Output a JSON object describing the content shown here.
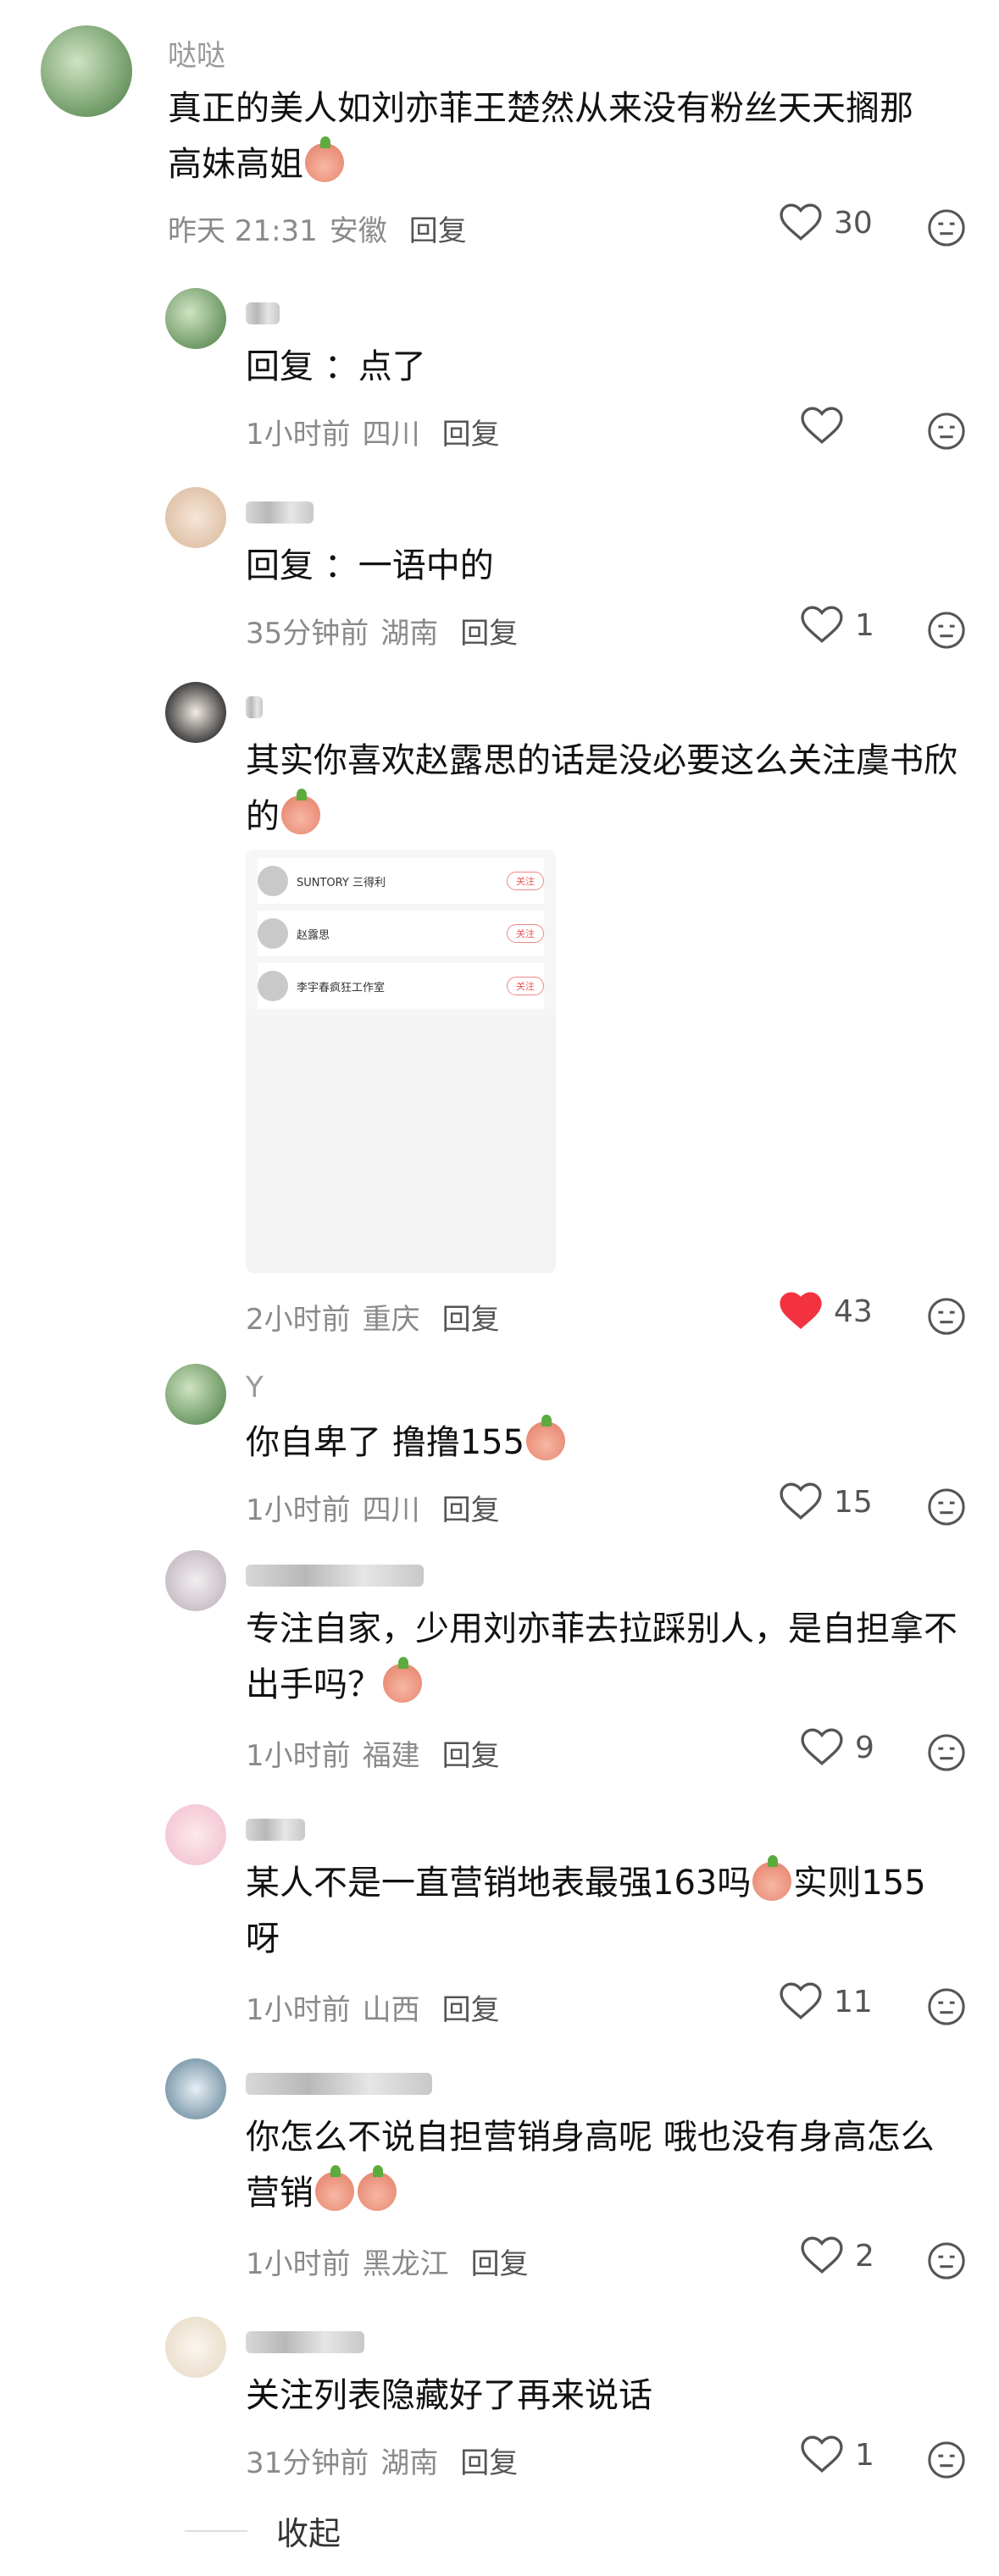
{
  "comments": [
    {
      "nickname": "哒哒",
      "text": "真正的美人如刘亦菲王楚然从来没有粉丝天天搁那高妹高姐",
      "time": "昨天 21:31",
      "location": "安徽",
      "reply": "回复",
      "likes": "30",
      "liked": false
    },
    {
      "nickname": "",
      "text": "回复 ：点了",
      "time": "1小时前",
      "location": "四川",
      "reply": "回复",
      "likes": "",
      "liked": false
    },
    {
      "nickname": "",
      "text": "回复 ：一语中的",
      "time": "35分钟前",
      "location": "湖南",
      "reply": "回复",
      "likes": "1",
      "liked": false
    },
    {
      "nickname": "",
      "text": "其实你喜欢赵露思的话是没必要这么关注虞书欣的",
      "time": "2小时前",
      "location": "重庆",
      "reply": "回复",
      "likes": "43",
      "liked": true,
      "attachment": {
        "rows": [
          {
            "name": "SUNTORY 三得利",
            "follow": "关注"
          },
          {
            "name": "赵露思",
            "follow": "关注"
          },
          {
            "name": "李宇春疯狂工作室",
            "follow": "关注"
          }
        ]
      }
    },
    {
      "nickname": "Y",
      "text": "你自卑了 撸撸155",
      "time": "1小时前",
      "location": "四川",
      "reply": "回复",
      "likes": "15",
      "liked": false
    },
    {
      "nickname": "",
      "text": "专注自家，少用刘亦菲去拉踩别人，是自担拿不出手吗？",
      "time": "1小时前",
      "location": "福建",
      "reply": "回复",
      "likes": "9",
      "liked": false
    },
    {
      "nickname": "",
      "text": "某人不是一直营销地表最强163吗",
      "text2": "实则155呀",
      "time": "1小时前",
      "location": "山西",
      "reply": "回复",
      "likes": "11",
      "liked": false
    },
    {
      "nickname": "",
      "text": "你怎么不说自担营销身高呢 哦也没有身高怎么营销",
      "time": "1小时前",
      "location": "黑龙江",
      "reply": "回复",
      "likes": "2",
      "liked": false
    },
    {
      "nickname": "",
      "text": "关注列表隐藏好了再来说话",
      "time": "31分钟前",
      "location": "湖南",
      "reply": "回复",
      "likes": "1",
      "liked": false
    }
  ],
  "collapse_label": "收起",
  "colors": {
    "liked_heart": "#f2333f",
    "meta_gray": "#8a8a8a"
  }
}
